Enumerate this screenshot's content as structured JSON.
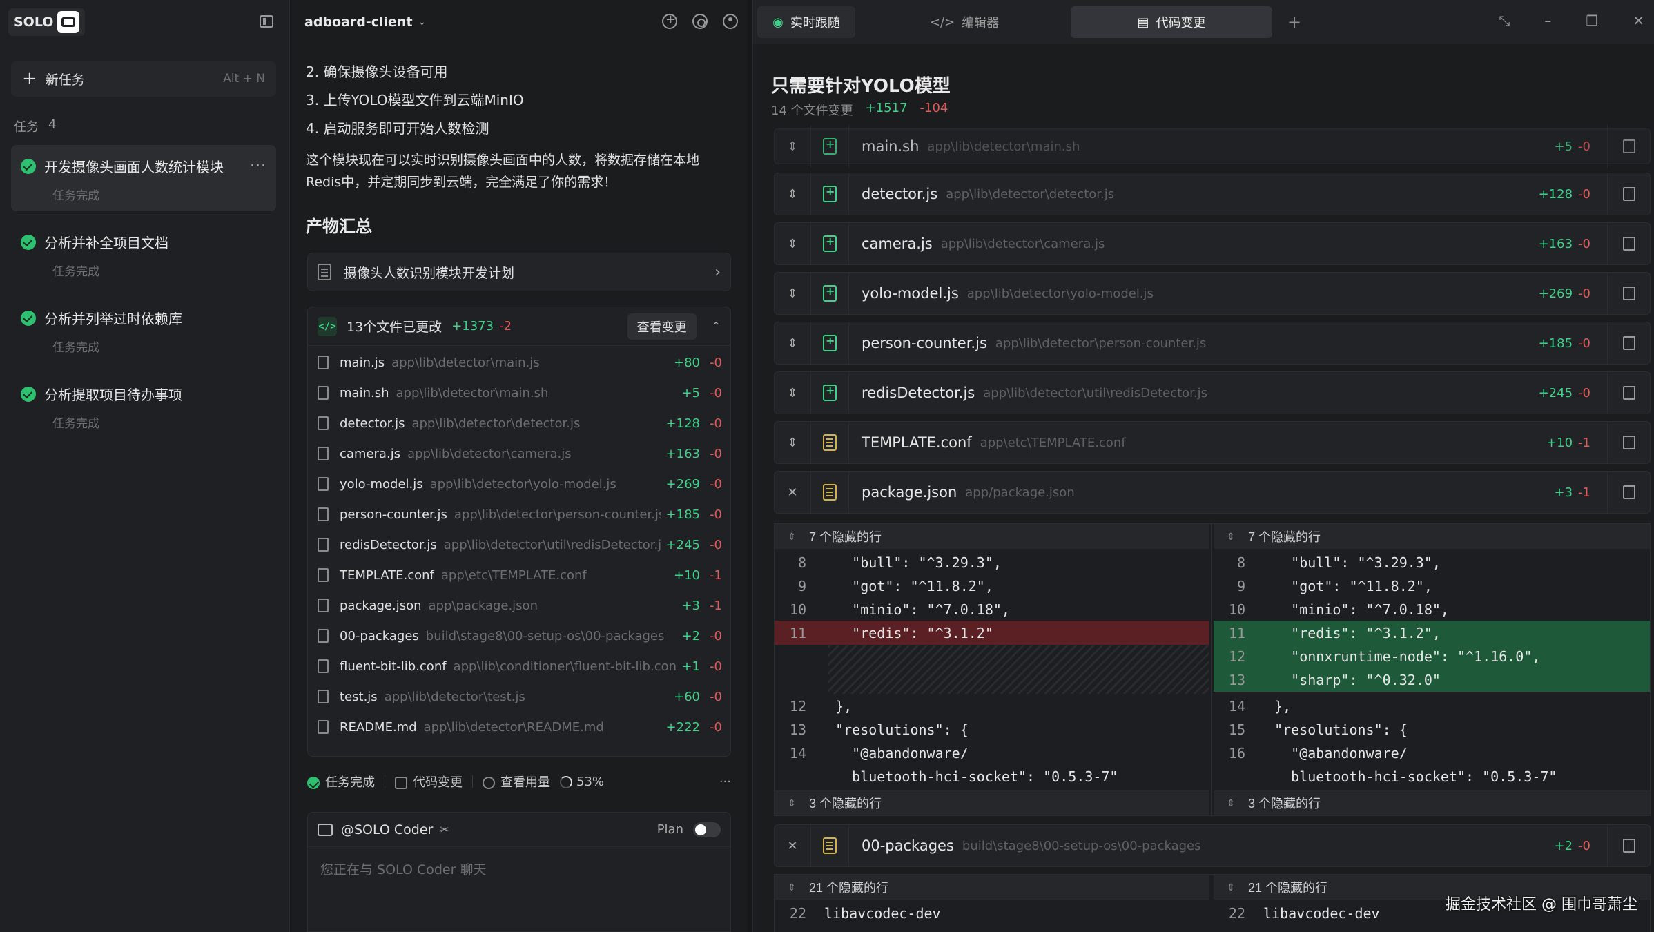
{
  "sidebar": {
    "logo_text": "SOLO",
    "new_task_label": "新任务",
    "new_task_shortcut": "Alt + N",
    "tasks_label": "任务",
    "tasks_count": "4",
    "tasks": [
      {
        "title": "开发摄像头画面人数统计模块",
        "status": "任务完成",
        "active": true
      },
      {
        "title": "分析并补全项目文档",
        "status": "任务完成"
      },
      {
        "title": "分析并列举过时依赖库",
        "status": "任务完成"
      },
      {
        "title": "分析提取项目待办事项",
        "status": "任务完成"
      }
    ]
  },
  "chat": {
    "project": "adboard-client",
    "steps": [
      "2. 确保摄像头设备可用",
      "3. 上传YOLO模型文件到云端MinIO",
      "4. 启动服务即可开始人数检测"
    ],
    "paragraph": "这个模块现在可以实时识别摄像头画面中的人数，将数据存储在本地Redis中，并定期同步到云端，完全满足了你的需求！",
    "section_title": "产物汇总",
    "plan_card": "摄像头人数识别模块开发计划",
    "files_changed": "13个文件已更改",
    "files_add": "+1373",
    "files_del": "-2",
    "view_changes": "查看变更",
    "files": [
      {
        "name": "main.js",
        "path": "app\\lib\\detector\\main.js",
        "add": "+80",
        "del": "-0"
      },
      {
        "name": "main.sh",
        "path": "app\\lib\\detector\\main.sh",
        "add": "+5",
        "del": "-0"
      },
      {
        "name": "detector.js",
        "path": "app\\lib\\detector\\detector.js",
        "add": "+128",
        "del": "-0"
      },
      {
        "name": "camera.js",
        "path": "app\\lib\\detector\\camera.js",
        "add": "+163",
        "del": "-0"
      },
      {
        "name": "yolo-model.js",
        "path": "app\\lib\\detector\\yolo-model.js",
        "add": "+269",
        "del": "-0"
      },
      {
        "name": "person-counter.js",
        "path": "app\\lib\\detector\\person-counter.js",
        "add": "+185",
        "del": "-0"
      },
      {
        "name": "redisDetector.js",
        "path": "app\\lib\\detector\\util\\redisDetector.js",
        "add": "+245",
        "del": "-0"
      },
      {
        "name": "TEMPLATE.conf",
        "path": "app\\etc\\TEMPLATE.conf",
        "add": "+10",
        "del": "-1"
      },
      {
        "name": "package.json",
        "path": "app\\package.json",
        "add": "+3",
        "del": "-1"
      },
      {
        "name": "00-packages",
        "path": "build\\stage8\\00-setup-os\\00-packages",
        "add": "+2",
        "del": "-0"
      },
      {
        "name": "fluent-bit-lib.conf",
        "path": "app\\lib\\conditioner\\fluent-bit-lib.conf",
        "add": "+1",
        "del": "-0"
      },
      {
        "name": "test.js",
        "path": "app\\lib\\detector\\test.js",
        "add": "+60",
        "del": "-0"
      },
      {
        "name": "README.md",
        "path": "app\\lib\\detector\\README.md",
        "add": "+222",
        "del": "-0"
      }
    ],
    "status": {
      "done": "任务完成",
      "code_changes": "代码变更",
      "usage": "查看用量",
      "progress": "53%"
    },
    "composer": {
      "agent": "@SOLO Coder",
      "plan_label": "Plan",
      "placeholder": "您正在与 SOLO Coder 聊天"
    }
  },
  "right": {
    "tabs": [
      "实时跟随",
      "编辑器",
      "代码变更"
    ],
    "title": "只需要针对YOLO模型",
    "files_count": "14 个文件变更",
    "add": "+1517",
    "del": "-104",
    "files": [
      {
        "name": "main.sh",
        "path": "app\\lib\\detector\\main.sh",
        "add": "+5",
        "del": "-0",
        "kind": "new"
      },
      {
        "name": "detector.js",
        "path": "app\\lib\\detector\\detector.js",
        "add": "+128",
        "del": "-0",
        "kind": "new"
      },
      {
        "name": "camera.js",
        "path": "app\\lib\\detector\\camera.js",
        "add": "+163",
        "del": "-0",
        "kind": "new"
      },
      {
        "name": "yolo-model.js",
        "path": "app\\lib\\detector\\yolo-model.js",
        "add": "+269",
        "del": "-0",
        "kind": "new"
      },
      {
        "name": "person-counter.js",
        "path": "app\\lib\\detector\\person-counter.js",
        "add": "+185",
        "del": "-0",
        "kind": "new"
      },
      {
        "name": "redisDetector.js",
        "path": "app\\lib\\detector\\util\\redisDetector.js",
        "add": "+245",
        "del": "-0",
        "kind": "new"
      },
      {
        "name": "TEMPLATE.conf",
        "path": "app\\etc\\TEMPLATE.conf",
        "add": "+10",
        "del": "-1",
        "kind": "mod"
      },
      {
        "name": "package.json",
        "path": "app/package.json",
        "add": "+3",
        "del": "-1",
        "kind": "mod"
      }
    ],
    "hidden_top": "7 个隐藏的行",
    "hidden_bottom": "3 个隐藏的行",
    "left_lines": [
      {
        "ln": "8",
        "code": "    \"bull\": \"^3.29.3\","
      },
      {
        "ln": "9",
        "code": "    \"got\": \"^11.8.2\","
      },
      {
        "ln": "10",
        "code": "    \"minio\": \"^7.0.18\","
      },
      {
        "ln": "11",
        "code": "    \"redis\": \"^3.1.2\""
      },
      {
        "ln": "12",
        "code": "  },"
      },
      {
        "ln": "13",
        "code": "  \"resolutions\": {"
      },
      {
        "ln": "14",
        "code": "    \"@abandonware/"
      },
      {
        "ln": "",
        "code": "    bluetooth-hci-socket\": \"0.5.3-7\""
      }
    ],
    "right_lines": [
      {
        "ln": "8",
        "code": "    \"bull\": \"^3.29.3\","
      },
      {
        "ln": "9",
        "code": "    \"got\": \"^11.8.2\","
      },
      {
        "ln": "10",
        "code": "    \"minio\": \"^7.0.18\","
      },
      {
        "ln": "11",
        "code": "    \"redis\": \"^3.1.2\","
      },
      {
        "ln": "12",
        "code": "    \"onnxruntime-node\": \"^1.16.0\","
      },
      {
        "ln": "13",
        "code": "    \"sharp\": \"^0.32.0\""
      },
      {
        "ln": "14",
        "code": "  },"
      },
      {
        "ln": "15",
        "code": "  \"resolutions\": {"
      },
      {
        "ln": "16",
        "code": "    \"@abandonware/"
      },
      {
        "ln": "",
        "code": "    bluetooth-hci-socket\": \"0.5.3-7\""
      }
    ],
    "pkg2": {
      "name": "00-packages",
      "path": "build\\stage8\\00-setup-os\\00-packages",
      "add": "+2",
      "del": "-0"
    },
    "hidden_pkg2": "21 个隐藏的行",
    "pkg2_line": {
      "ln": "22",
      "code": "libavcodec-dev"
    }
  },
  "watermark": "掘金技术社区 @ 围巾哥萧尘"
}
